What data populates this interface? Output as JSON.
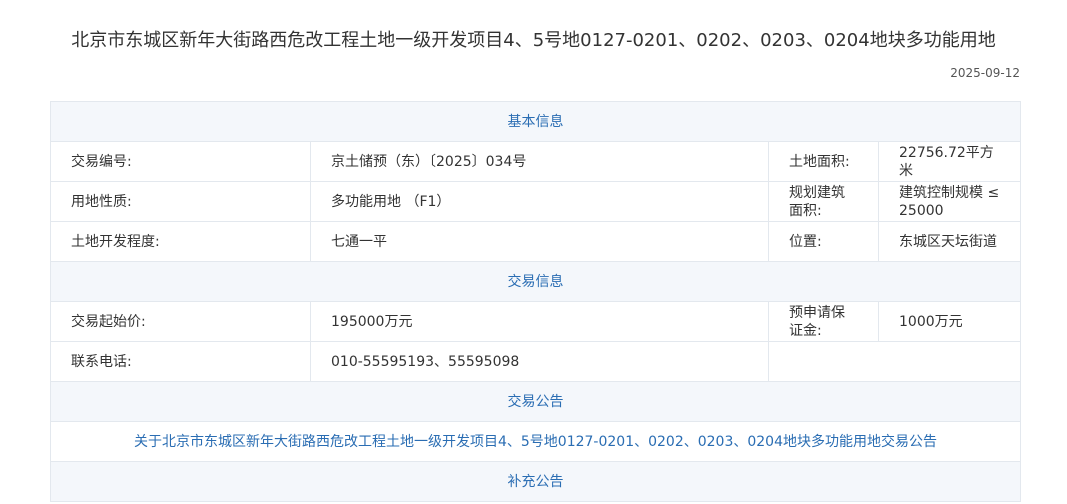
{
  "title": "北京市东城区新年大街路西危改工程土地一级开发项目4、5号地0127-0201、0202、0203、0204地块多功能用地",
  "date": "2025-09-12",
  "sections": {
    "basic": "基本信息",
    "trade": "交易信息",
    "notice": "交易公告",
    "supplement": "补充公告"
  },
  "basic": {
    "trade_no_label": "交易编号:",
    "trade_no": "京土储预（东）〔2025〕034号",
    "area_label": "土地面积:",
    "area": "22756.72平方米",
    "use_label": "用地性质:",
    "use": "多功能用地 （F1）",
    "build_area_label": "规划建筑面积:",
    "build_area": "建筑控制规模 ≤ 25000",
    "dev_label": "土地开发程度:",
    "dev": "七通一平",
    "location_label": "位置:",
    "location": "东城区天坛街道"
  },
  "trade": {
    "start_price_label": "交易起始价:",
    "start_price": "195000万元",
    "deposit_label": "预申请保证金:",
    "deposit": "1000万元",
    "phone_label": "联系电话:",
    "phone": "010-55595193、55595098"
  },
  "notice_link": "关于北京市东城区新年大街路西危改工程土地一级开发项目4、5号地0127-0201、0202、0203、0204地块多功能用地交易公告"
}
